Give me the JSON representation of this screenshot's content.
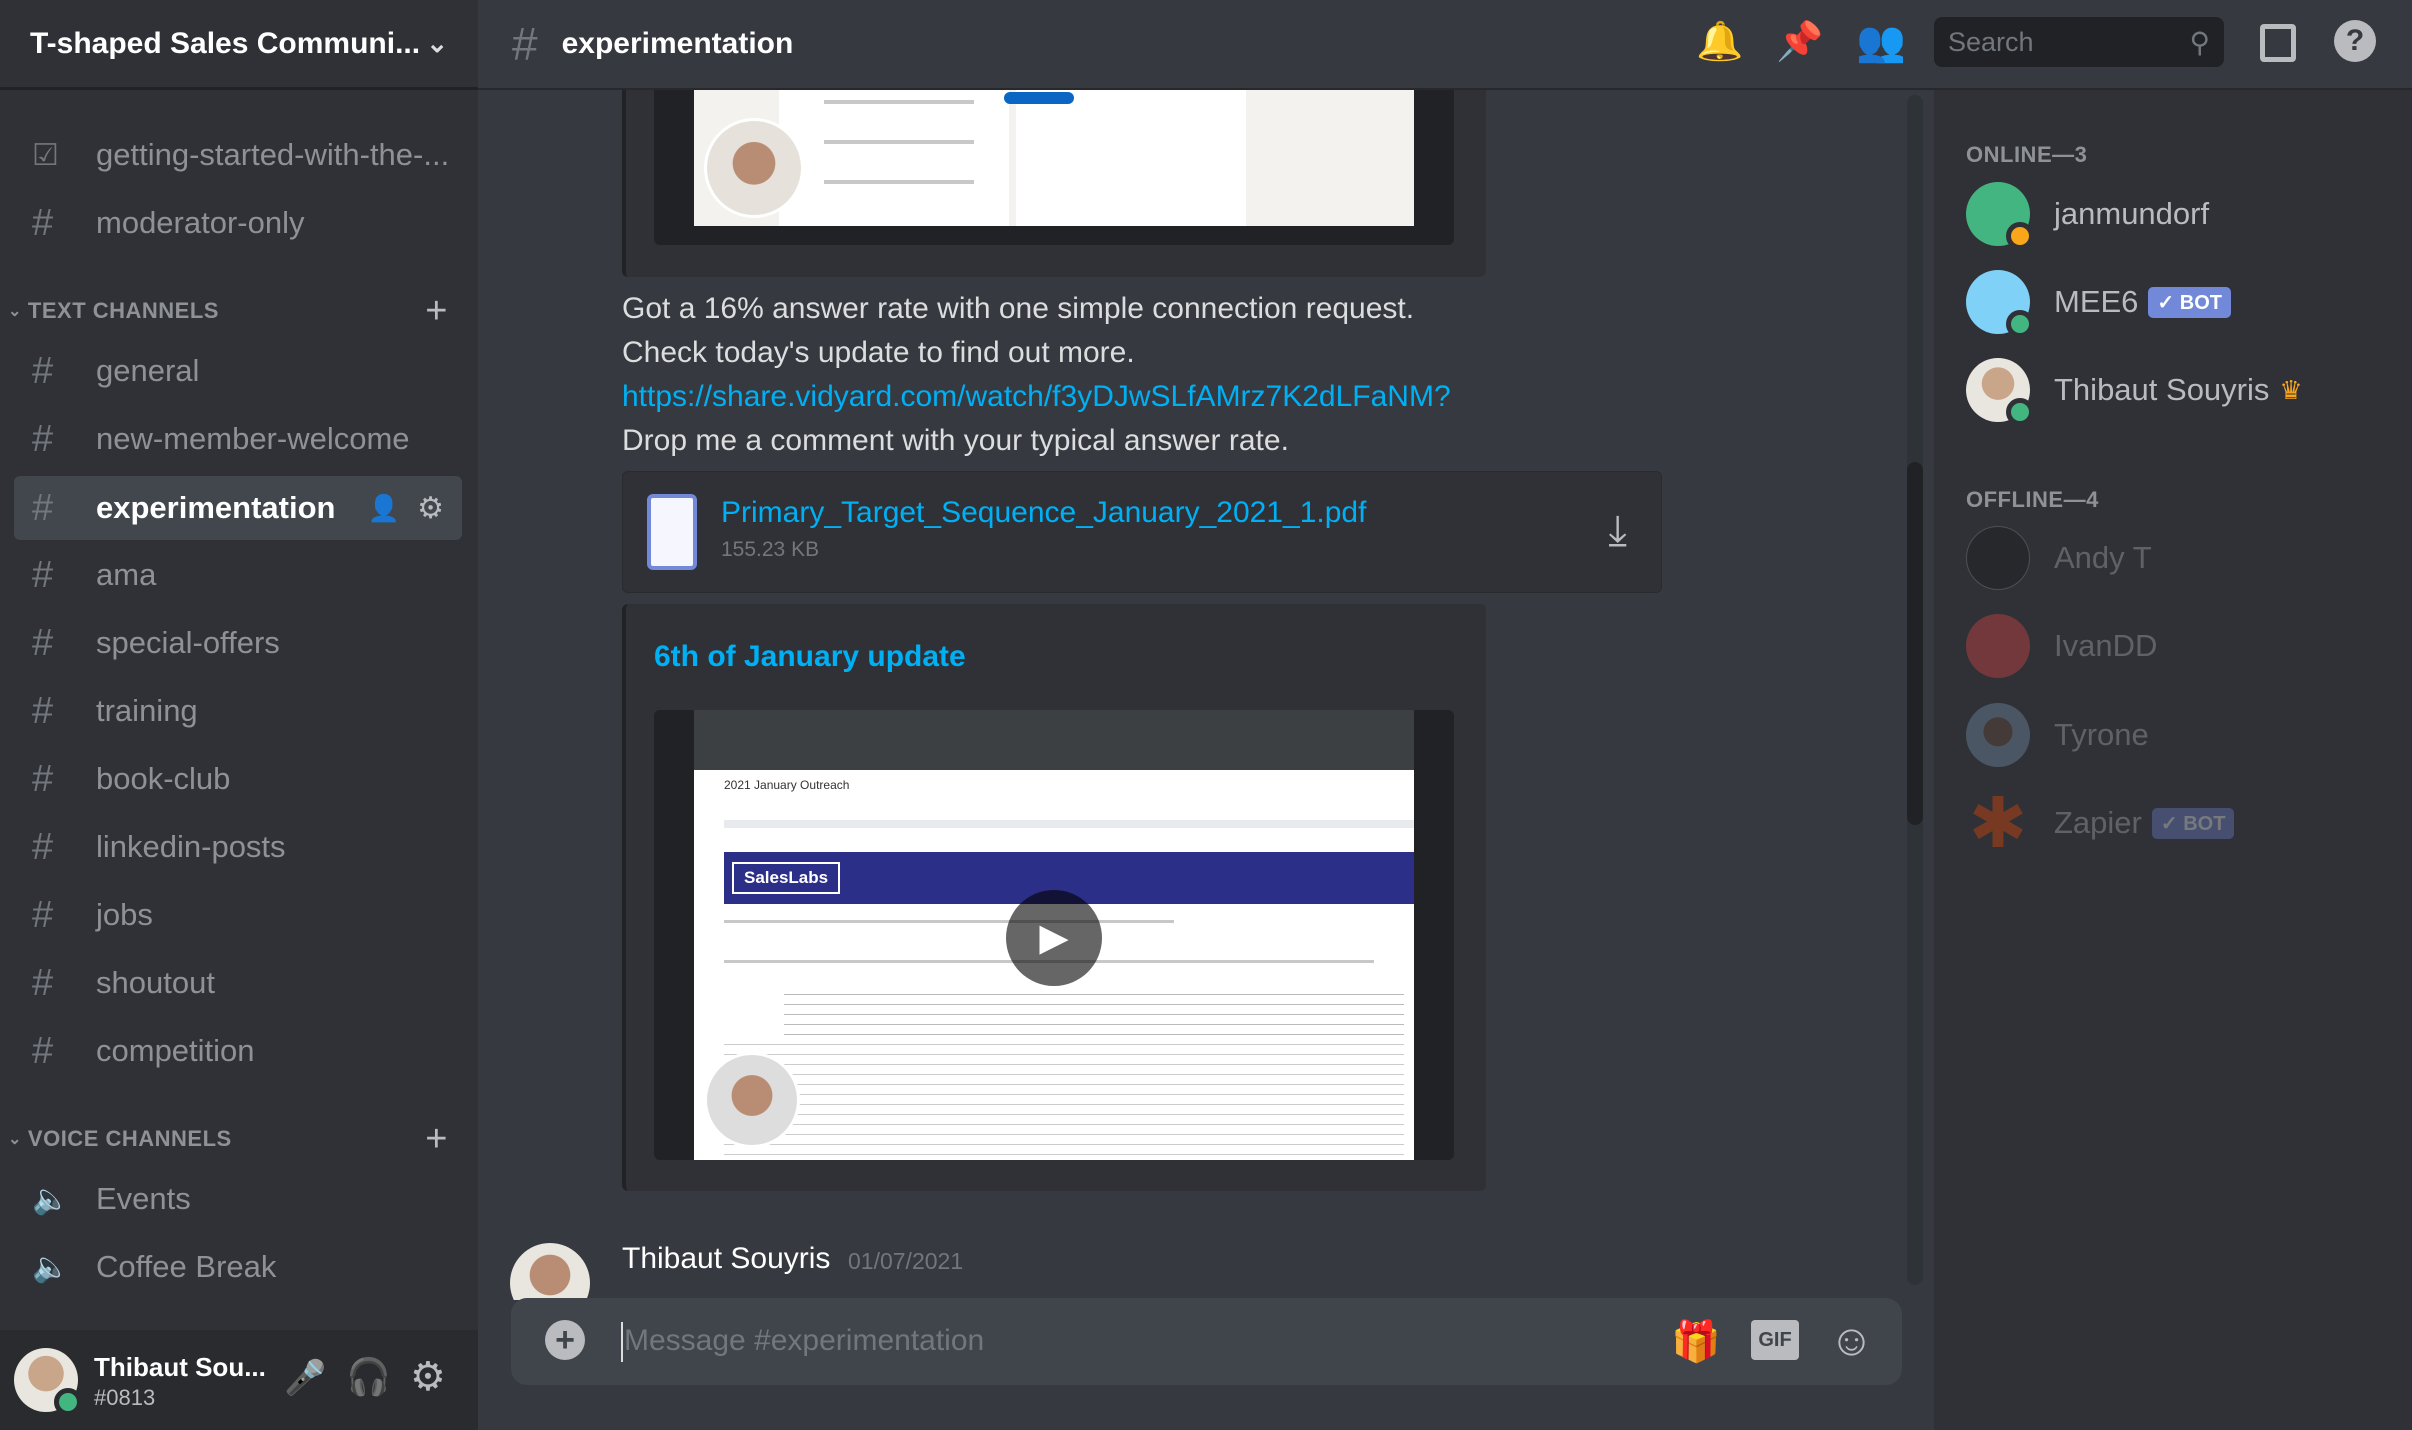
{
  "server": {
    "name": "T-shaped Sales Communi..."
  },
  "channel": {
    "name": "experimentation",
    "composer_placeholder": "Message #experimentation"
  },
  "sidebar": {
    "top_channels": [
      {
        "label": "getting-started-with-the-...",
        "icon": "rules-icon"
      },
      {
        "label": "moderator-only",
        "icon": "locked-hash-icon"
      }
    ],
    "text_category": "TEXT CHANNELS",
    "text_channels": [
      {
        "label": "general"
      },
      {
        "label": "new-member-welcome"
      },
      {
        "label": "experimentation",
        "selected": true
      },
      {
        "label": "ama"
      },
      {
        "label": "special-offers"
      },
      {
        "label": "training"
      },
      {
        "label": "book-club"
      },
      {
        "label": "linkedin-posts"
      },
      {
        "label": "jobs"
      },
      {
        "label": "shoutout"
      },
      {
        "label": "competition"
      }
    ],
    "voice_category": "VOICE CHANNELS",
    "voice_channels": [
      {
        "label": "Events"
      },
      {
        "label": "Coffee Break"
      }
    ]
  },
  "user": {
    "name": "Thibaut Sou...",
    "tag": "#0813",
    "status_color": "#43b581"
  },
  "header": {
    "search_placeholder": "Search"
  },
  "messages": {
    "lines": [
      "Got a 16% answer rate with one simple connection request.",
      "Check today's update to find out more.",
      "https://share.vidyard.com/watch/f3yDJwSLfAMrz7K2dLFaNM?",
      "Drop me a comment with your typical answer rate."
    ],
    "attachment": {
      "filename": "Primary_Target_Sequence_January_2021_1.pdf",
      "size": "155.23 KB"
    },
    "embed": {
      "title": "6th of January update",
      "sheet_title": "2021 January Outreach",
      "brand": "SalesLabs"
    },
    "next": {
      "author": "Thibaut Souyris",
      "date": "01/07/2021"
    }
  },
  "members": {
    "online_header": "ONLINE—3",
    "offline_header": "OFFLINE—4",
    "bot_label": "BOT",
    "online": [
      {
        "name": "janmundorf",
        "avatar_color": "#43b581",
        "status": "idle"
      },
      {
        "name": "MEE6",
        "avatar_color": "#7fd1f7",
        "bot": true,
        "status": "online"
      },
      {
        "name": "Thibaut Souyris",
        "owner": true,
        "status": "online"
      }
    ],
    "offline": [
      {
        "name": "Andy T",
        "avatar_color": "#1a1a1a"
      },
      {
        "name": "IvanDD",
        "avatar_color": "#f04747"
      },
      {
        "name": "Tyrone",
        "avatar_color": "#5a7a9a"
      },
      {
        "name": "Zapier",
        "avatar_color": "#ff4a00",
        "bot": true
      }
    ]
  },
  "colors": {
    "link": "#00b0f4",
    "accent": "#7289da",
    "online": "#43b581",
    "idle": "#faa61a"
  }
}
